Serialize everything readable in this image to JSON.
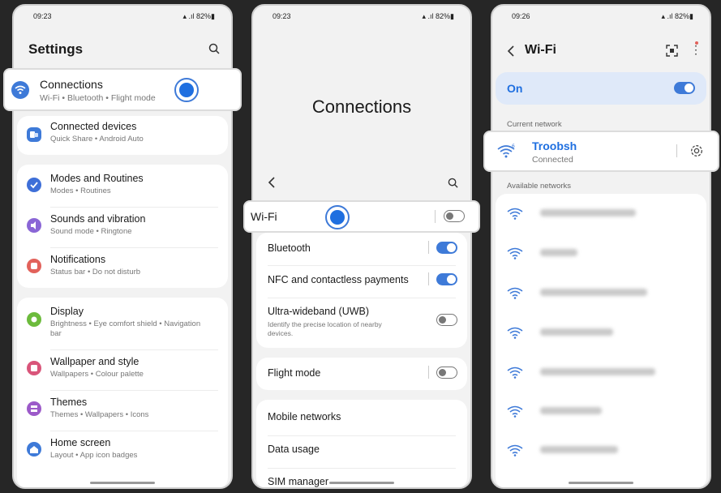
{
  "status": {
    "p1_time": "09:23",
    "p2_time": "09:23",
    "p3_time": "09:26",
    "battery": "82%"
  },
  "p1": {
    "title": "Settings",
    "items": [
      {
        "title": "Connections",
        "sub": "Wi-Fi  •  Bluetooth  •  Flight mode",
        "color": "#3e7ad8",
        "icon": "wifi-icon"
      },
      {
        "title": "Connected devices",
        "sub": "Quick Share  •  Android Auto",
        "color": "#3e7ad8",
        "icon": "connected-devices-icon"
      },
      {
        "title": "Modes and Routines",
        "sub": "Modes  •  Routines",
        "color": "#3e6fd8",
        "icon": "modes-icon"
      },
      {
        "title": "Sounds and vibration",
        "sub": "Sound mode  •  Ringtone",
        "color": "#8a66d6",
        "icon": "sound-icon"
      },
      {
        "title": "Notifications",
        "sub": "Status bar  •  Do not disturb",
        "color": "#e2625b",
        "icon": "notification-icon"
      },
      {
        "title": "Display",
        "sub": "Brightness  •  Eye comfort shield  •  Navigation",
        "sub2": "bar",
        "color": "#6cbb3c",
        "icon": "display-icon"
      },
      {
        "title": "Wallpaper and style",
        "sub": "Wallpapers  •  Colour palette",
        "color": "#d9557a",
        "icon": "wallpaper-icon"
      },
      {
        "title": "Themes",
        "sub": "Themes  •  Wallpapers  •  Icons",
        "color": "#9c5ac9",
        "icon": "themes-icon"
      },
      {
        "title": "Home screen",
        "sub": "Layout  •  App icon badges",
        "color": "#3e7ad8",
        "icon": "home-icon"
      }
    ]
  },
  "p2": {
    "title": "Connections",
    "wifi": "Wi-Fi",
    "bluetooth": "Bluetooth",
    "nfc": "NFC and contactless payments",
    "uwb": "Ultra-wideband (UWB)",
    "uwb_sub1": "Identify the precise location of nearby",
    "uwb_sub2": "devices.",
    "flight": "Flight mode",
    "mobile": "Mobile networks",
    "data": "Data usage",
    "sim": "SIM manager"
  },
  "p3": {
    "title": "Wi-Fi",
    "on_label": "On",
    "current_header": "Current network",
    "current_name": "Troobsh",
    "current_status": "Connected",
    "available_header": "Available networks",
    "accent": "#1f6fe0"
  }
}
